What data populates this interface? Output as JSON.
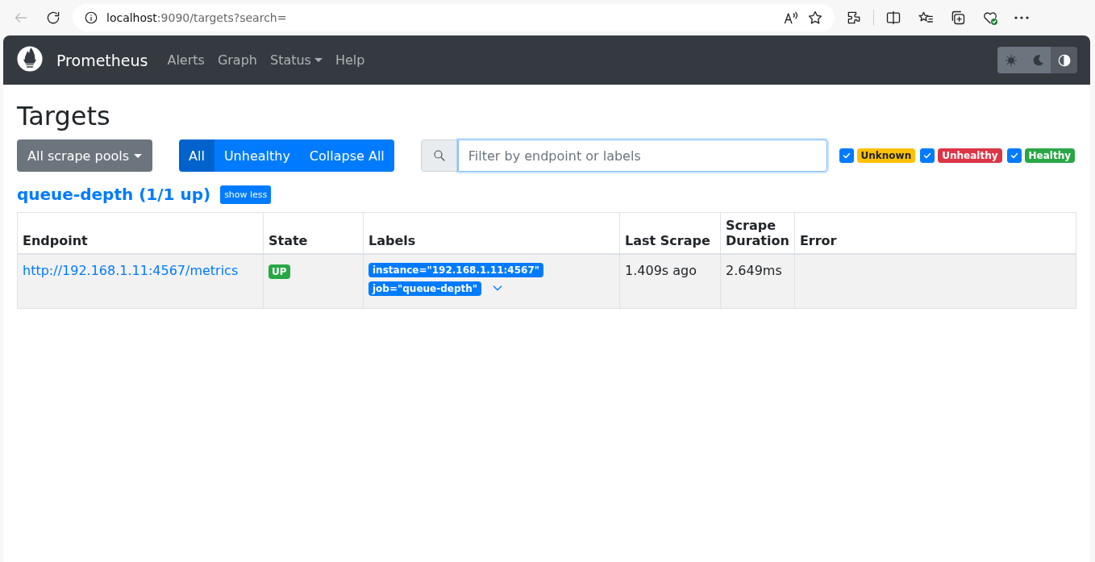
{
  "browser": {
    "url_host": "localhost",
    "url_rest": ":9090/targets?search="
  },
  "navbar": {
    "brand": "Prometheus",
    "items": [
      {
        "label": "Alerts",
        "dropdown": false
      },
      {
        "label": "Graph",
        "dropdown": false
      },
      {
        "label": "Status",
        "dropdown": true
      },
      {
        "label": "Help",
        "dropdown": false
      }
    ],
    "theme_buttons": [
      {
        "kind": "light",
        "selected": false
      },
      {
        "kind": "dark",
        "selected": false
      },
      {
        "kind": "auto",
        "selected": true
      }
    ]
  },
  "page_title": "Targets",
  "pool_dropdown": "All scrape pools",
  "filter_buttons": [
    {
      "label": "All",
      "selected": true
    },
    {
      "label": "Unhealthy",
      "selected": false
    },
    {
      "label": "Collapse All",
      "selected": false
    }
  ],
  "search": {
    "placeholder": "Filter by endpoint or labels"
  },
  "health_filters": [
    {
      "label": "Unknown",
      "checked": true,
      "color": "#ffc107"
    },
    {
      "label": "Unhealthy",
      "checked": true,
      "color": "#dc3545"
    },
    {
      "label": "Healthy",
      "checked": true,
      "color": "#28a745"
    }
  ],
  "pool": {
    "title": "queue-depth (1/1 up)",
    "toggle": "show less",
    "table": {
      "columns": [
        "Endpoint",
        "State",
        "Labels",
        "Last Scrape",
        "Scrape Duration",
        "Error"
      ],
      "rows": [
        {
          "endpoint": "http://192.168.1.11:4567/metrics",
          "state": "UP",
          "color": "#28a745",
          "labels": [
            "instance=\"192.168.1.11:4567\"",
            "job=\"queue-depth\""
          ],
          "last_scrape": "1.409s ago",
          "duration": "2.649ms"
        }
      ]
    }
  }
}
